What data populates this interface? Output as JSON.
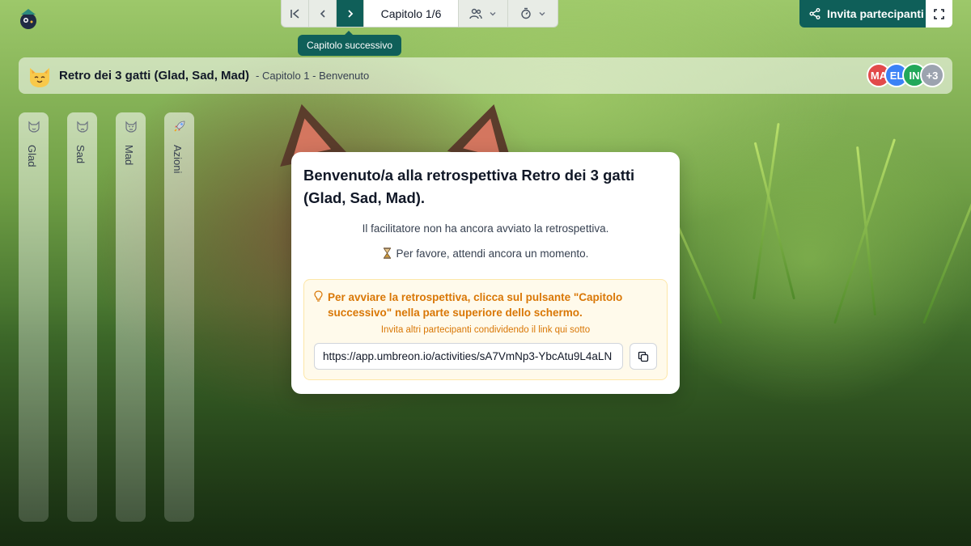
{
  "toolbar": {
    "chapter_label": "Capitolo 1/6",
    "tooltip": "Capitolo successivo"
  },
  "topright": {
    "invite_label": "Invita partecipanti"
  },
  "header": {
    "title": "Retro dei 3 gatti (Glad, Sad, Mad)",
    "subtitle": "- Capitolo 1 - Benvenuto",
    "avatars": [
      {
        "initials": "MA",
        "color": "#e24a4a"
      },
      {
        "initials": "EL",
        "color": "#3b82f6"
      },
      {
        "initials": "IN",
        "color": "#22a85a"
      },
      {
        "initials": "+3",
        "color": "#9ca3af"
      }
    ]
  },
  "columns": [
    {
      "label": "Glad",
      "icon": "smile-cat-icon"
    },
    {
      "label": "Sad",
      "icon": "sad-cat-icon"
    },
    {
      "label": "Mad",
      "icon": "angry-cat-icon"
    },
    {
      "label": "Azioni",
      "icon": "rocket-icon"
    }
  ],
  "modal": {
    "title": "Benvenuto/a alla retrospettiva Retro dei 3 gatti (Glad, Sad, Mad).",
    "line1": "Il facilitatore non ha ancora avviato la retrospettiva.",
    "line2": "Per favore, attendi ancora un momento.",
    "hint_main": "Per avviare la retrospettiva, clicca sul pulsante \"Capitolo successivo\" nella parte superiore dello schermo.",
    "hint_sub": "Invita altri partecipanti condividendo il link qui sotto",
    "link_value": "https://app.umbreon.io/activities/sA7VmNp3-YbcAtu9L4aLN"
  },
  "colors": {
    "primary": "#0f5f59",
    "warning": "#d97706"
  }
}
